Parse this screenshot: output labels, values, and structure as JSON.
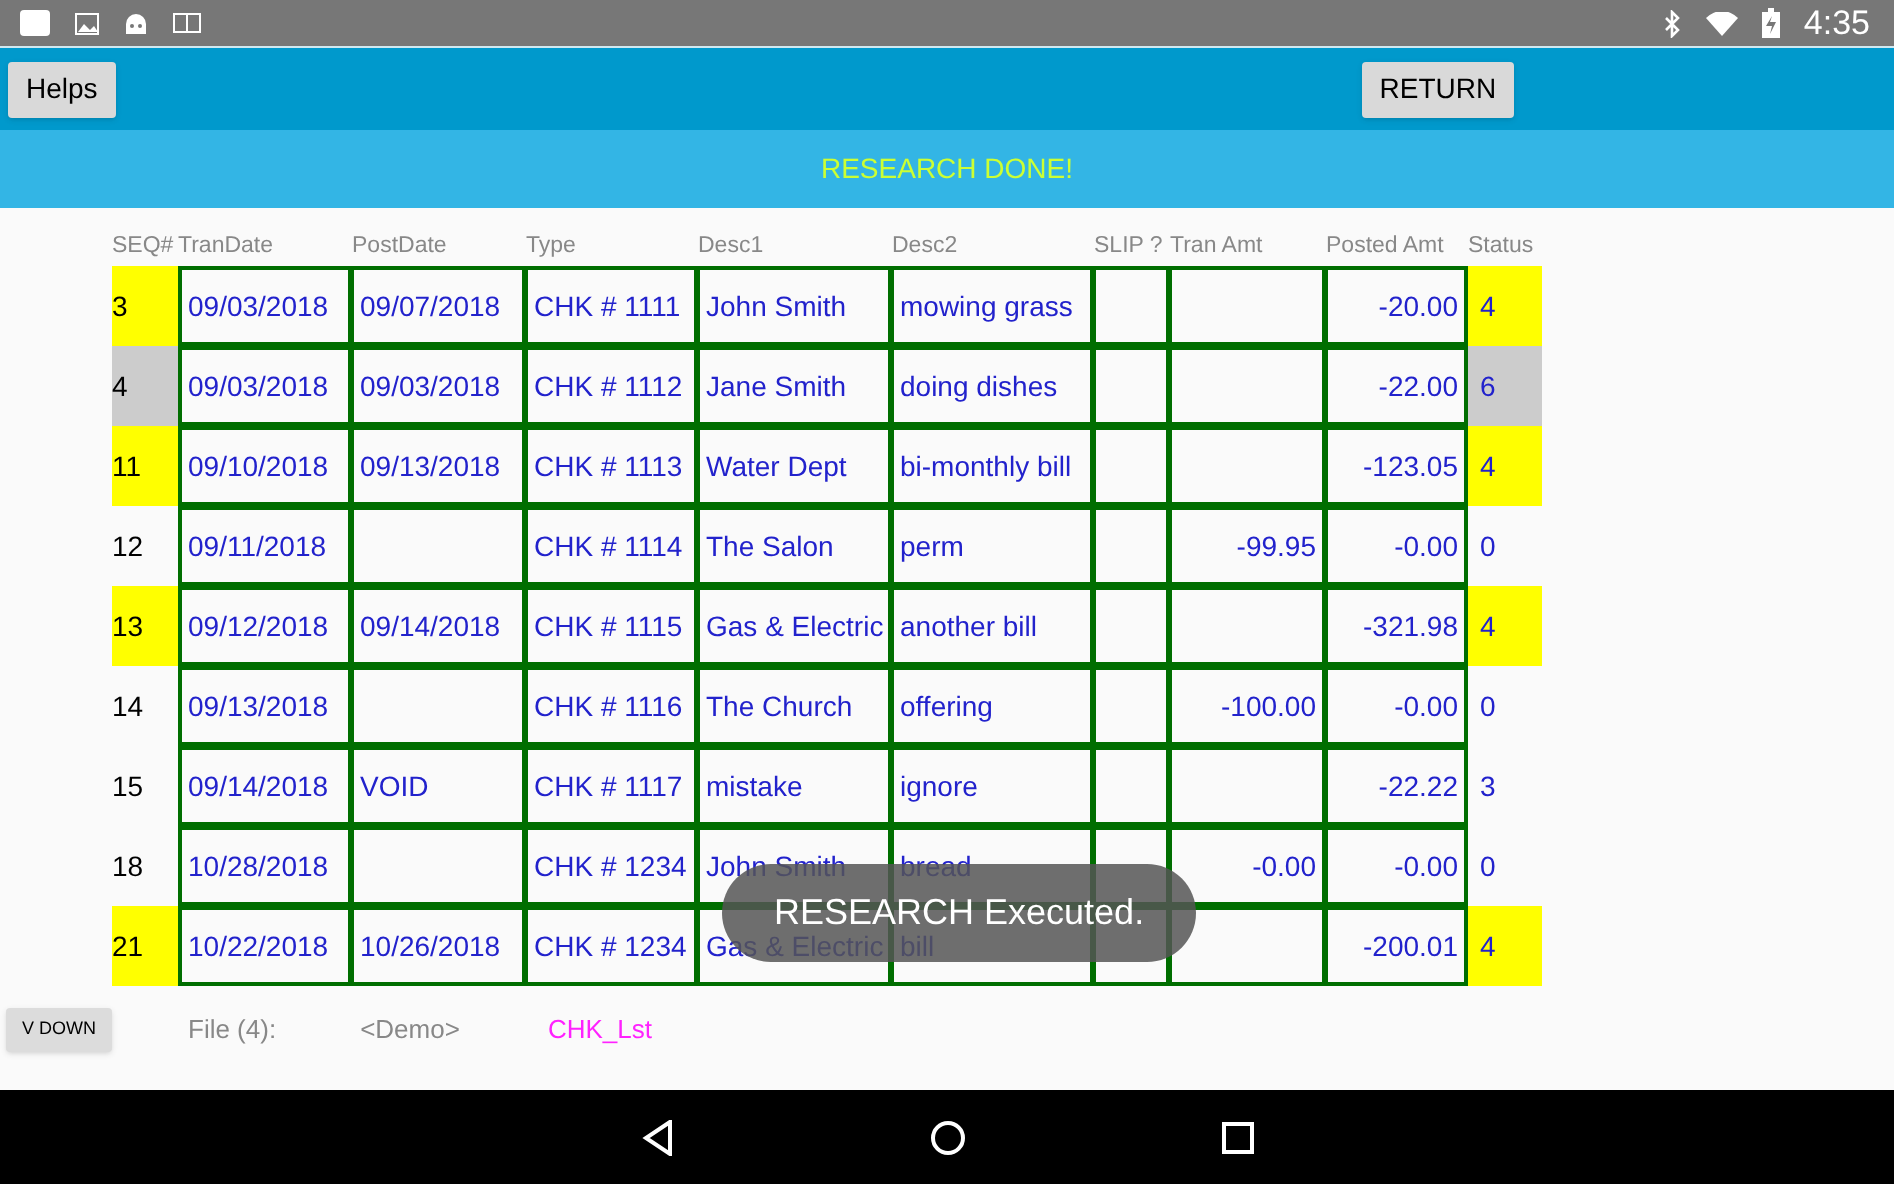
{
  "status_bar": {
    "time": "4:35"
  },
  "toolbar": {
    "buttons": [
      "Helps",
      "RETURN"
    ]
  },
  "banner": "RESEARCH DONE!",
  "table": {
    "columns": [
      "SEQ#",
      "TranDate",
      "PostDate",
      "Type",
      "Desc1",
      "Desc2",
      "SLIP ?",
      "Tran Amt",
      "Posted Amt",
      "Status"
    ],
    "rows": [
      {
        "seq": "3",
        "tran_date": "09/03/2018",
        "post_date": "09/07/2018",
        "type": "CHK # 1111",
        "desc1": "John Smith",
        "desc2": "mowing grass",
        "slip": "",
        "tran_amt": "",
        "posted_amt": "-20.00",
        "status": "4",
        "color": "#ffff00"
      },
      {
        "seq": "4",
        "tran_date": "09/03/2018",
        "post_date": "09/03/2018",
        "type": "CHK # 1112",
        "desc1": "Jane Smith",
        "desc2": "doing dishes",
        "slip": "",
        "tran_amt": "",
        "posted_amt": "-22.00",
        "status": "6",
        "color": "#cccccc"
      },
      {
        "seq": "11",
        "tran_date": "09/10/2018",
        "post_date": "09/13/2018",
        "type": "CHK # 1113",
        "desc1": "Water Dept",
        "desc2": "bi-monthly bill",
        "slip": "",
        "tran_amt": "",
        "posted_amt": "-123.05",
        "status": "4",
        "color": "#ffff00"
      },
      {
        "seq": "12",
        "tran_date": "09/11/2018",
        "post_date": "",
        "type": "CHK # 1114",
        "desc1": "The Salon",
        "desc2": "perm",
        "slip": "",
        "tran_amt": "-99.95",
        "posted_amt": "-0.00",
        "status": "0"
      },
      {
        "seq": "13",
        "tran_date": "09/12/2018",
        "post_date": "09/14/2018",
        "type": "CHK # 1115",
        "desc1": "Gas & Electric",
        "desc2": "another bill",
        "slip": "",
        "tran_amt": "",
        "posted_amt": "-321.98",
        "status": "4",
        "color": "#ffff00"
      },
      {
        "seq": "14",
        "tran_date": "09/13/2018",
        "post_date": "",
        "type": "CHK # 1116",
        "desc1": "The Church",
        "desc2": "offering",
        "slip": "",
        "tran_amt": "-100.00",
        "posted_amt": "-0.00",
        "status": "0"
      },
      {
        "seq": "15",
        "tran_date": "09/14/2018",
        "post_date": "VOID",
        "type": "CHK # 1117",
        "desc1": "mistake",
        "desc2": "ignore",
        "slip": "",
        "tran_amt": "",
        "posted_amt": "-22.22",
        "status": "3"
      },
      {
        "seq": "18",
        "tran_date": "10/28/2018",
        "post_date": "",
        "type": "CHK # 1234",
        "desc1": "John Smith",
        "desc2": "bread",
        "slip": "",
        "tran_amt": "-0.00",
        "posted_amt": "-0.00",
        "status": "0"
      },
      {
        "seq": "21",
        "tran_date": "10/22/2018",
        "post_date": "10/26/2018",
        "type": "CHK # 1234",
        "desc1": "Gas & Electric",
        "desc2": "bill",
        "slip": "",
        "tran_amt": "",
        "posted_amt": "-200.01",
        "status": "4",
        "color": "#ffff00"
      }
    ]
  },
  "footer": {
    "button": "V DOWN",
    "file_label": "File (4):",
    "file_name": "<Demo>",
    "list_name": "CHK_Lst"
  },
  "toast": "RESEARCH Executed."
}
